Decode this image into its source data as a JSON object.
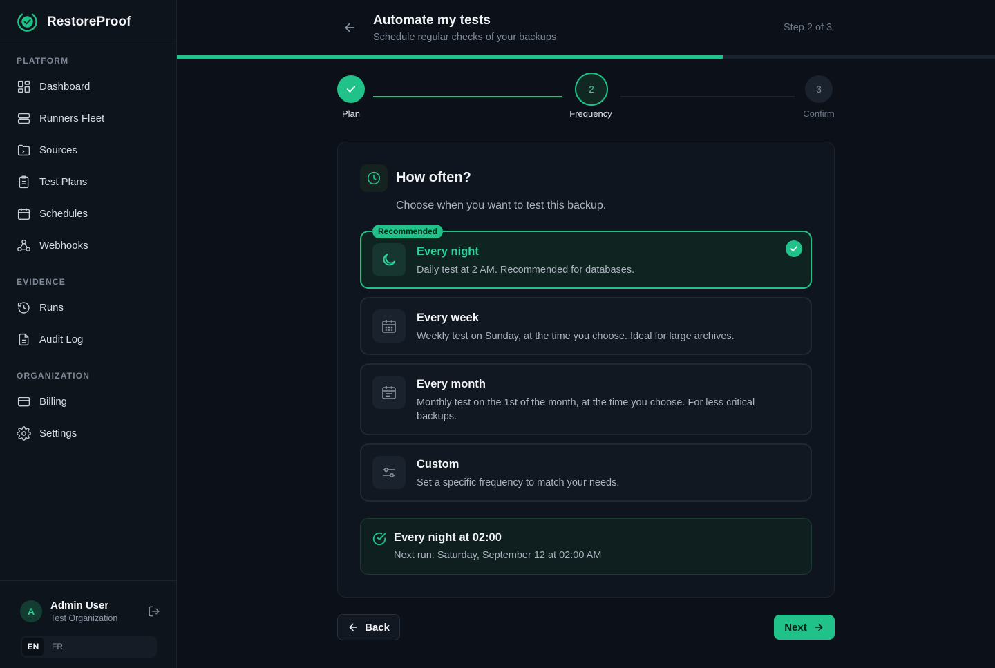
{
  "brand": {
    "name": "RestoreProof",
    "logo_icon": "check-circle-logo-icon",
    "accent": "#20c28a"
  },
  "sidebar": {
    "sections": [
      {
        "title": "PLATFORM",
        "items": [
          {
            "label": "Dashboard",
            "icon": "dashboard-icon"
          },
          {
            "label": "Runners Fleet",
            "icon": "server-icon"
          },
          {
            "label": "Sources",
            "icon": "folder-icon"
          },
          {
            "label": "Test Plans",
            "icon": "clipboard-icon"
          },
          {
            "label": "Schedules",
            "icon": "calendar-icon"
          },
          {
            "label": "Webhooks",
            "icon": "webhook-icon"
          }
        ]
      },
      {
        "title": "EVIDENCE",
        "items": [
          {
            "label": "Runs",
            "icon": "history-icon"
          },
          {
            "label": "Audit Log",
            "icon": "file-text-icon"
          }
        ]
      },
      {
        "title": "ORGANIZATION",
        "items": [
          {
            "label": "Billing",
            "icon": "credit-card-icon"
          },
          {
            "label": "Settings",
            "icon": "gear-icon"
          }
        ]
      }
    ],
    "user": {
      "initial": "A",
      "name": "Admin User",
      "org": "Test Organization"
    },
    "languages": {
      "active": "EN",
      "other": "FR"
    }
  },
  "header": {
    "title": "Automate my tests",
    "subtitle": "Schedule regular checks of your backups",
    "step": "Step 2 of 3",
    "progress": 0.667
  },
  "stepper": [
    {
      "number": "1",
      "label": "Plan",
      "state": "done"
    },
    {
      "number": "2",
      "label": "Frequency",
      "state": "current"
    },
    {
      "number": "3",
      "label": "Confirm",
      "state": "upcoming"
    }
  ],
  "card": {
    "title": "How often?",
    "description": "Choose when you want to test this backup.",
    "options": [
      {
        "title": "Every night",
        "desc": "Daily test at 2 AM. Recommended for databases.",
        "badge": "Recommended",
        "selected": true,
        "icon": "moon-icon"
      },
      {
        "title": "Every week",
        "desc": "Weekly test on Sunday, at the time you choose. Ideal for large archives.",
        "selected": false,
        "icon": "calendar-week-icon"
      },
      {
        "title": "Every month",
        "desc": "Monthly test on the 1st of the month, at the time you choose. For less critical backups.",
        "selected": false,
        "icon": "calendar-month-icon"
      },
      {
        "title": "Custom",
        "desc": "Set a specific frequency to match your needs.",
        "selected": false,
        "icon": "sliders-icon"
      }
    ],
    "summary": {
      "title": "Every night at 02:00",
      "next_run": "Next run: Saturday, September 12 at 02:00 AM"
    }
  },
  "actions": {
    "back": "Back",
    "next": "Next"
  }
}
